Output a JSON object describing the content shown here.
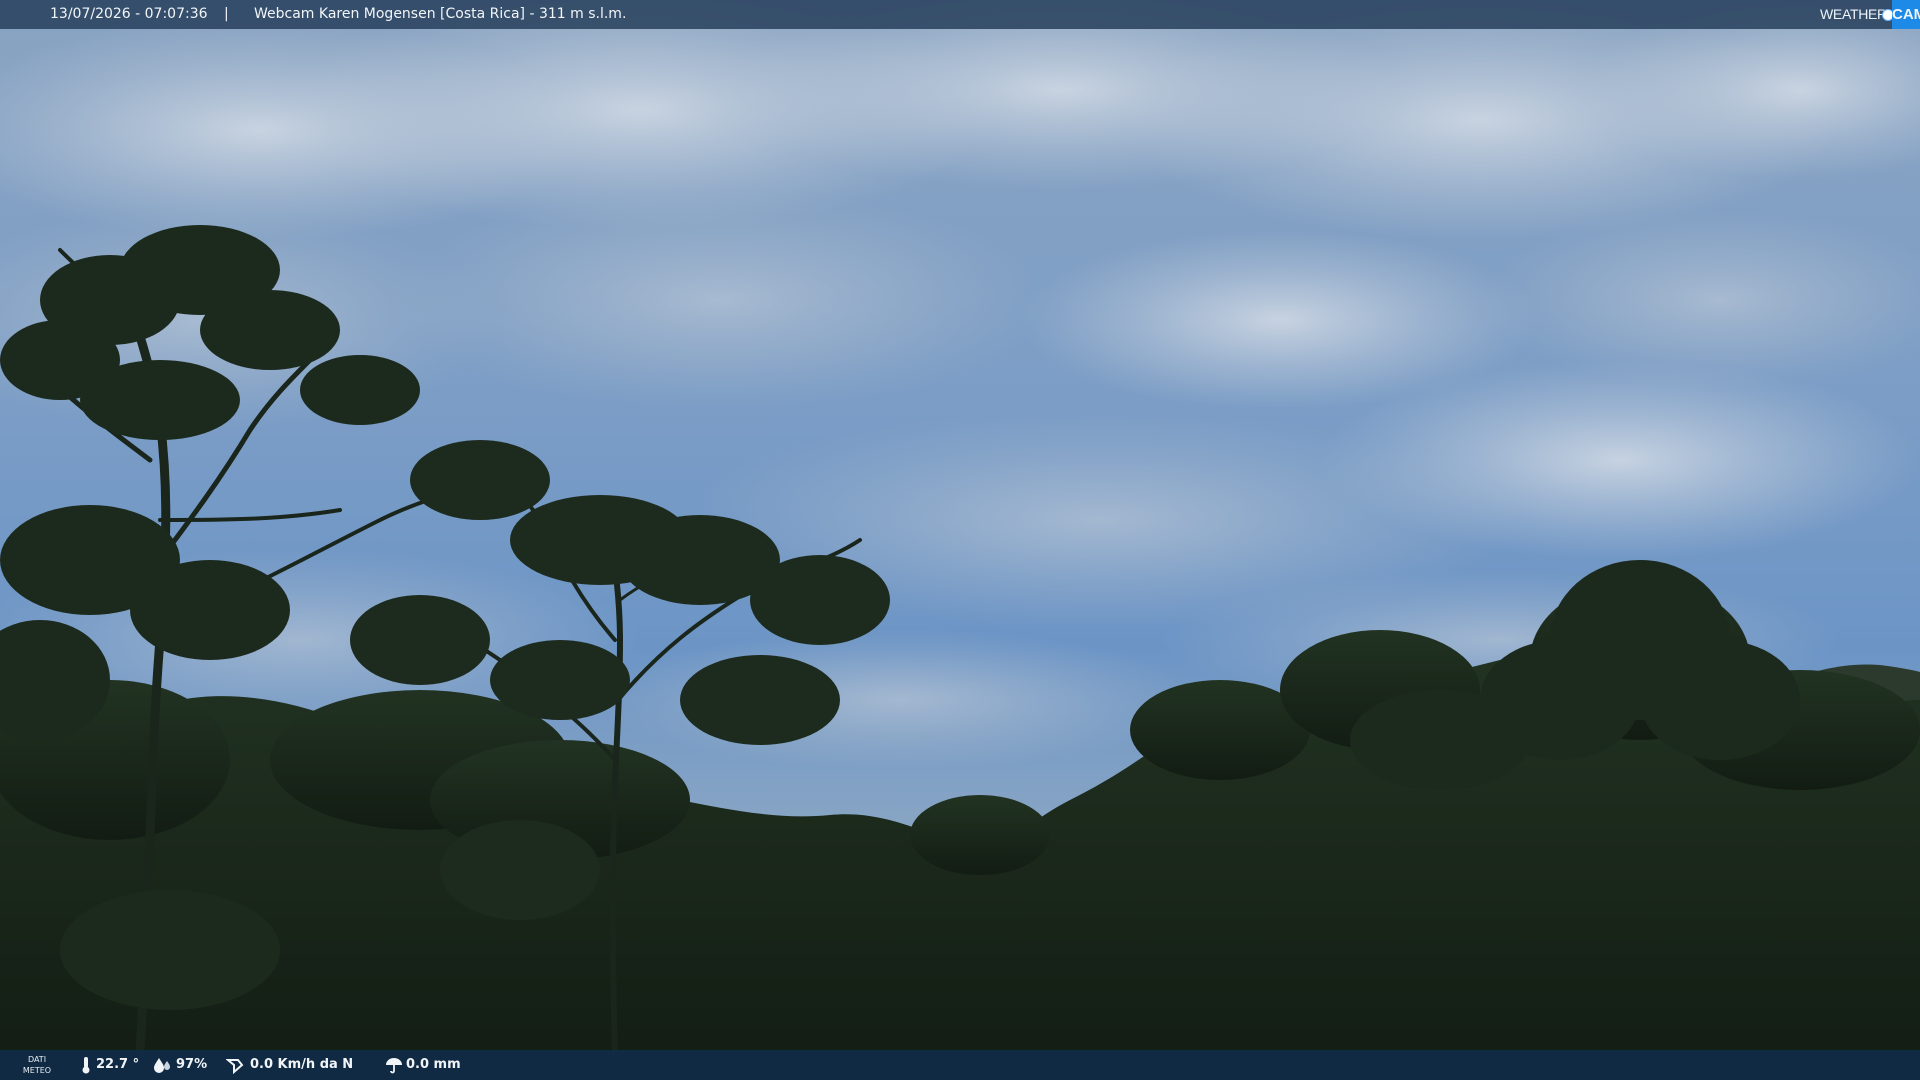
{
  "header": {
    "timestamp": "13/07/2026 - 07:07:36",
    "separator": "|",
    "title": "Webcam Karen Mogensen [Costa Rica] - 311 m s.l.m."
  },
  "logo": {
    "weather": "WEATHER",
    "cam": "CAM",
    "accent_color": "#1c8ae6"
  },
  "footer": {
    "dati_label": "DATI",
    "meteo_label": "METEO",
    "temperature": "22.7 °",
    "humidity": "97%",
    "wind": "0.0 Km/h da N",
    "rain": "0.0 mm",
    "icons": [
      "thermometer-icon",
      "humidity-icon",
      "wind-icon",
      "rain-icon"
    ]
  },
  "colors": {
    "sky_top": "#7f9dbd",
    "sky_mid": "#5f8fc4",
    "forest": "#1b2a1c"
  }
}
